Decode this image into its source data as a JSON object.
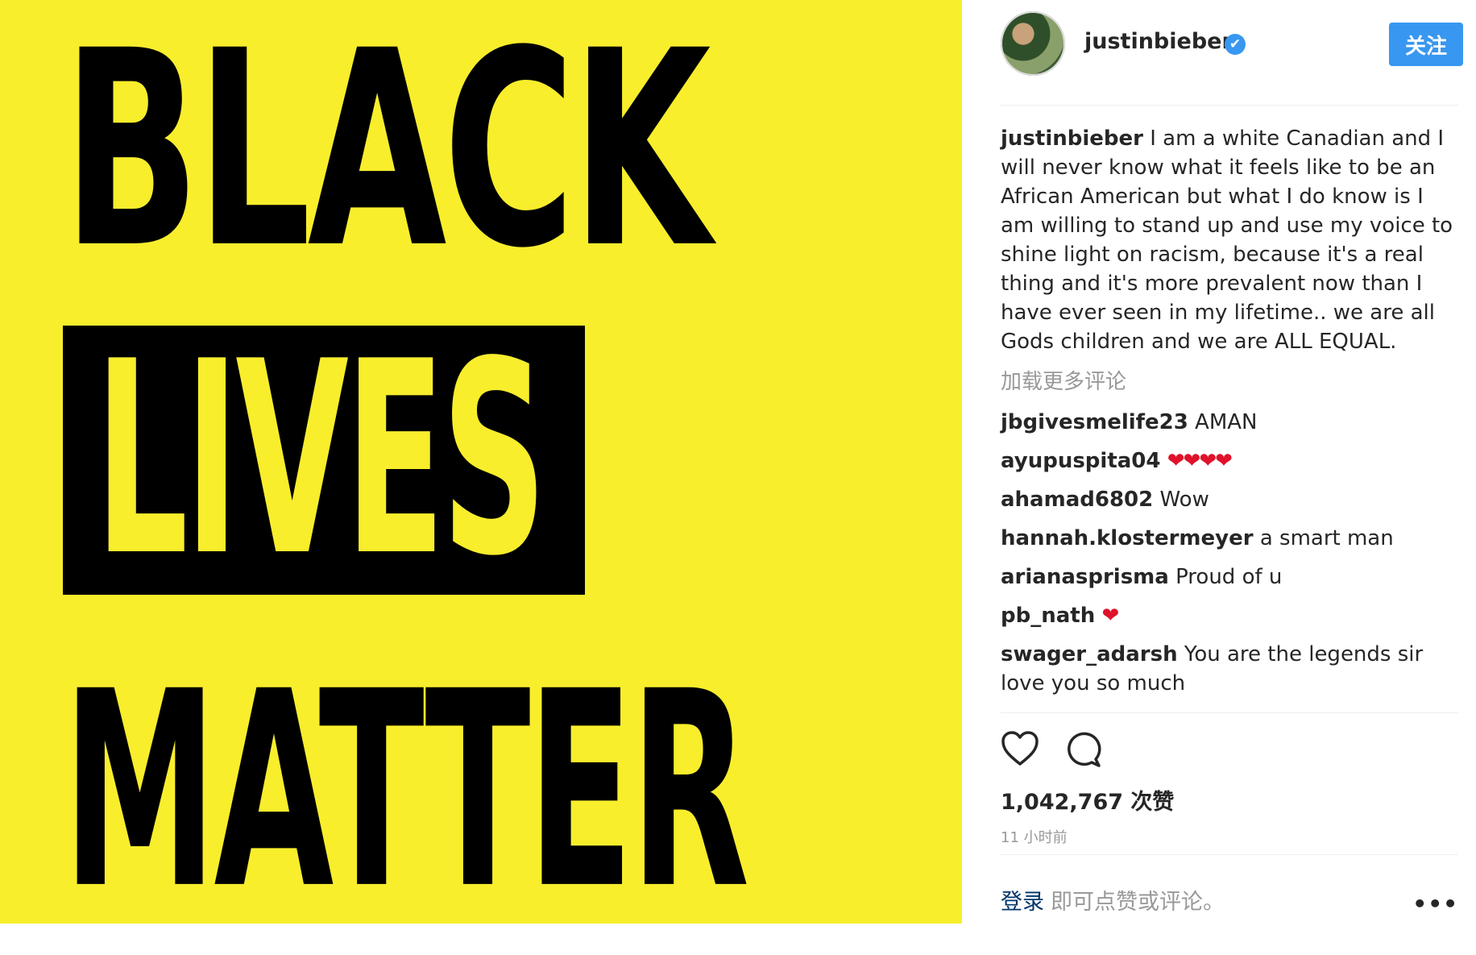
{
  "image_text": {
    "line1": "BLACK",
    "line2": "LIVES",
    "line3": "MATTER"
  },
  "header": {
    "username": "justinbieber",
    "verified_badge": "✔",
    "follow_label": "关注"
  },
  "caption": {
    "username": "justinbieber",
    "text": "I am a white Canadian and I will never know what it feels like to be an African American but what I do know is I am willing to stand up and use my voice to shine light on racism, because it's a real thing and it's more prevalent now than I have ever seen in my lifetime.. we are all Gods children and we are ALL EQUAL."
  },
  "load_more": "加载更多评论",
  "comments": [
    {
      "username": "jbgivesmelife23",
      "text": "AMAN"
    },
    {
      "username": "ayupuspita04",
      "text": "❤❤❤❤"
    },
    {
      "username": "ahamad6802",
      "text": "Wow"
    },
    {
      "username": "hannah.klostermeyer",
      "text": "a smart man"
    },
    {
      "username": "arianasprisma",
      "text": "Proud of u"
    },
    {
      "username": "pb_nath",
      "text": "❤"
    },
    {
      "username": "swager_adarsh",
      "text": "You are the legends sir love you so much"
    }
  ],
  "actions": {
    "like_icon": "heart-icon",
    "comment_icon": "comment-icon",
    "likes": "1,042,767 次赞",
    "timestamp": "11 小时前"
  },
  "footer": {
    "login_label": "登录",
    "login_rest": "即可点赞或评论。",
    "more": "•••"
  },
  "colors": {
    "image_bg": "#f8ee2c",
    "accent": "#3897f0",
    "muted": "#999999"
  }
}
